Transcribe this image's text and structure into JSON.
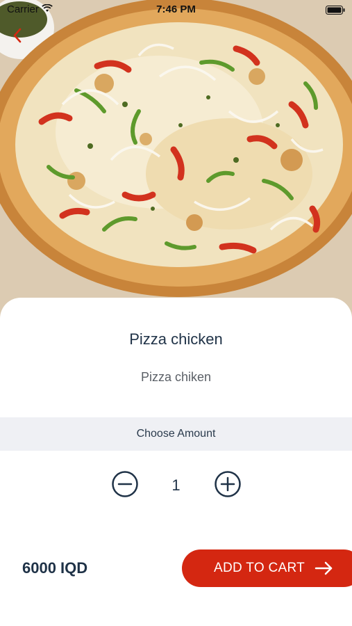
{
  "status_bar": {
    "carrier": "Carrier",
    "time": "7:46 PM"
  },
  "navigation": {
    "back_icon": "chevron-left-icon"
  },
  "product": {
    "image_icon": "pizza-image",
    "title": "Pizza chicken",
    "description": "Pizza chiken"
  },
  "amount": {
    "label": "Choose Amount",
    "quantity": "1",
    "decrement_icon": "minus-circle-icon",
    "increment_icon": "plus-circle-icon"
  },
  "checkout": {
    "price": "6000 IQD",
    "add_to_cart_label": "ADD TO CART",
    "arrow_icon": "arrow-right-icon"
  },
  "colors": {
    "accent": "#d42711",
    "text_dark": "#1f3247",
    "amount_bar_bg": "#eff0f4"
  }
}
